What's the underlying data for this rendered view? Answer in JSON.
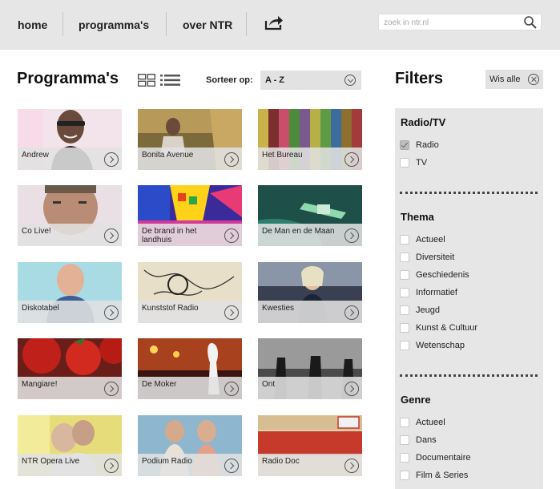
{
  "nav": {
    "home": "home",
    "programmas": "programma's",
    "over": "over NTR",
    "search_placeholder": "zoek in ntr.nl"
  },
  "page_title": "Programma's",
  "sort": {
    "label": "Sorteer op:",
    "value": "A - Z"
  },
  "programs": [
    {
      "title": "Andrew"
    },
    {
      "title": "Bonita Avenue"
    },
    {
      "title": "Het Bureau"
    },
    {
      "title": "Co Live!"
    },
    {
      "title": "De brand in het landhuis"
    },
    {
      "title": "De Man en de Maan"
    },
    {
      "title": "Diskotabel"
    },
    {
      "title": "Kunststof Radio"
    },
    {
      "title": "Kwesties"
    },
    {
      "title": "Mangiare!"
    },
    {
      "title": "De Moker"
    },
    {
      "title": "Ont"
    },
    {
      "title": "NTR Opera Live"
    },
    {
      "title": "Podium Radio"
    },
    {
      "title": "Radio Doc"
    }
  ],
  "filters": {
    "title": "Filters",
    "clear_all": "Wis alle",
    "groups": [
      {
        "title": "Radio/TV",
        "options": [
          {
            "label": "Radio",
            "checked": true
          },
          {
            "label": "TV",
            "checked": false
          }
        ]
      },
      {
        "title": "Thema",
        "options": [
          {
            "label": "Actueel",
            "checked": false
          },
          {
            "label": "Diversiteit",
            "checked": false
          },
          {
            "label": "Geschiedenis",
            "checked": false
          },
          {
            "label": "Informatief",
            "checked": false
          },
          {
            "label": "Jeugd",
            "checked": false
          },
          {
            "label": "Kunst & Cultuur",
            "checked": false
          },
          {
            "label": "Wetenschap",
            "checked": false
          }
        ]
      },
      {
        "title": "Genre",
        "options": [
          {
            "label": "Actueel",
            "checked": false
          },
          {
            "label": "Dans",
            "checked": false
          },
          {
            "label": "Documentaire",
            "checked": false
          },
          {
            "label": "Film & Series",
            "checked": false
          }
        ]
      }
    ]
  }
}
